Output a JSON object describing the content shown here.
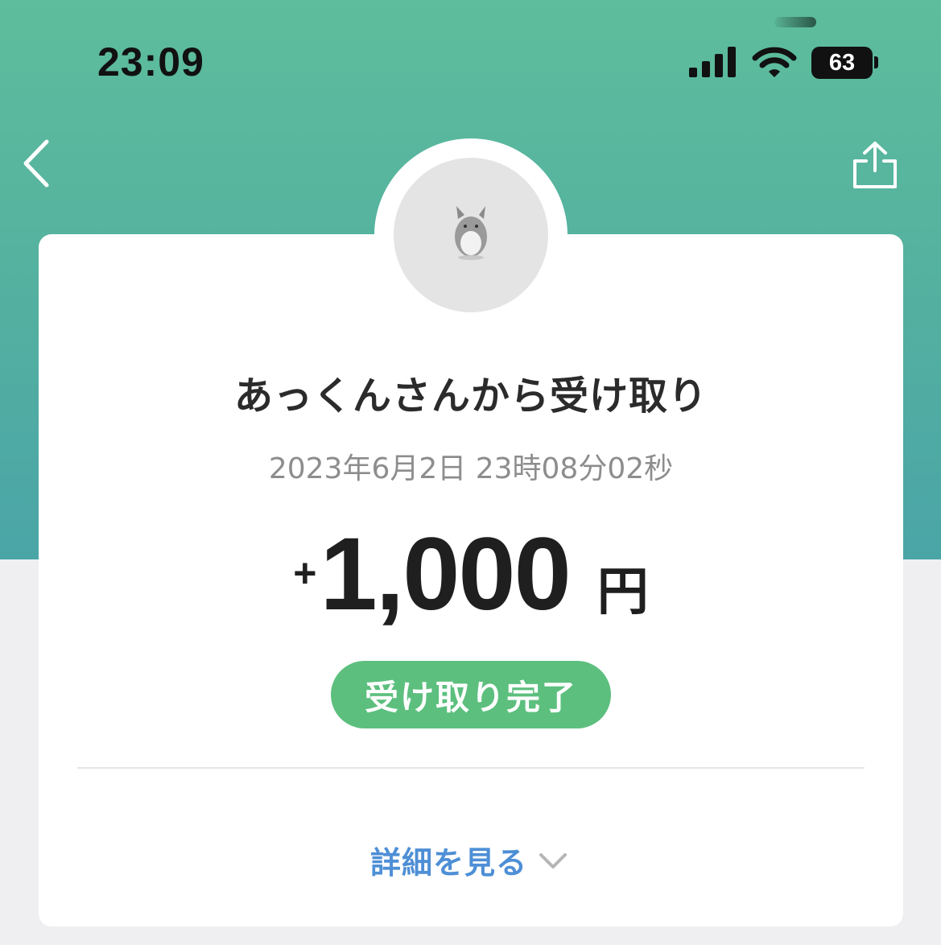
{
  "status_bar": {
    "time": "23:09",
    "battery": "63"
  },
  "header": {
    "back_icon": "chevron-left-icon",
    "share_icon": "share-icon"
  },
  "transaction": {
    "title": "あっくんさんから受け取り",
    "datetime": "2023年6月2日 23時08分02秒",
    "amount_sign": "+",
    "amount": "1,000",
    "currency": "円",
    "status": "受け取り完了"
  },
  "details": {
    "label": "詳細を見る",
    "icon": "chevron-down-icon"
  },
  "colors": {
    "header_gradient_top": "#5ebd9c",
    "header_gradient_bottom": "#4aa5a7",
    "status_green": "#5cbf7e",
    "link_blue": "#4e8fd6"
  }
}
